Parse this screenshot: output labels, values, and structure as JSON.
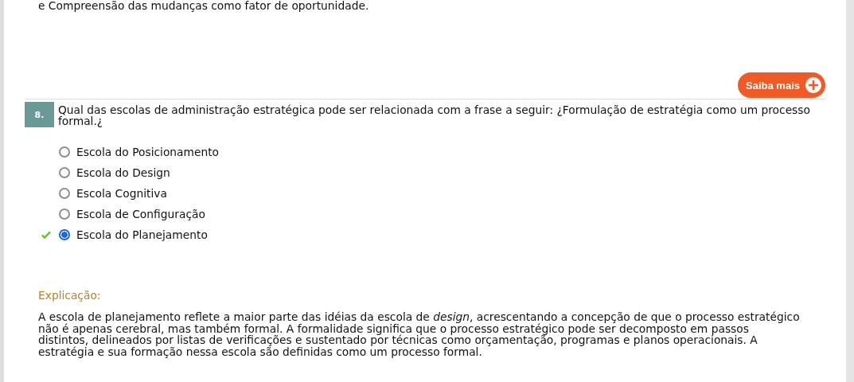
{
  "previous_text": "e Compreensão das mudanças como fator de oportunidade.",
  "more_button": {
    "label": "Saiba mais"
  },
  "question": {
    "number": "8.",
    "text": "Qual das escolas de administração estratégica pode ser relacionada com a frase a seguir: ¿Formulação de estratégia como um processo formal.¿",
    "options": [
      {
        "label": "Escola do Posicionamento",
        "selected": false,
        "correct": false
      },
      {
        "label": "Escola do Design",
        "selected": false,
        "correct": false
      },
      {
        "label": "Escola Cognitiva",
        "selected": false,
        "correct": false
      },
      {
        "label": "Escola de Configuração",
        "selected": false,
        "correct": false
      },
      {
        "label": "Escola do Planejamento",
        "selected": true,
        "correct": true
      }
    ]
  },
  "explanation": {
    "title": "Explicação:",
    "text": "A escola de planejamento reflete a maior parte das idéias da escola de *design*, acrescentando a concepção de que o processo estratégico não é apenas cerebral, mas também formal. A formalidade significa que o processo estratégico pode ser decomposto em passos distintos, delineados por listas de verificações e sustentado por técnicas como orçamentação, programas e planos operacionais. A estratégia e sua formação nessa escola são definidas como um processo formal."
  }
}
